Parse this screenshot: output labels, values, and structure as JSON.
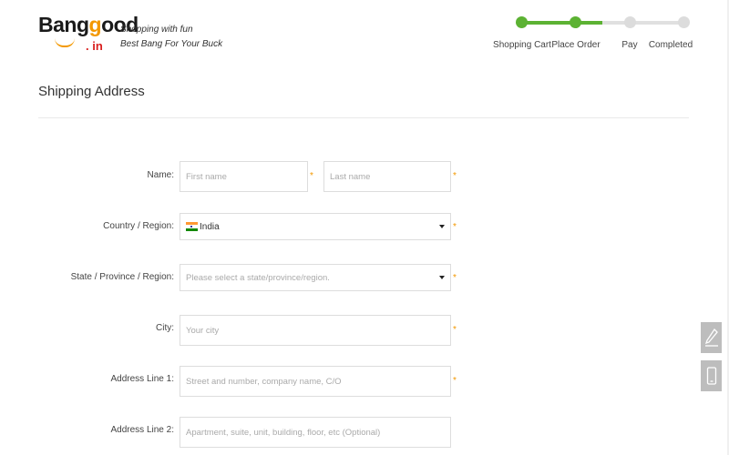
{
  "brand": {
    "word_part1": "Bang",
    "word_g": "g",
    "word_part2": "ood",
    "suffix": ". in",
    "tagline_1": "Shopping with fun",
    "tagline_2": "Best Bang For Your Buck"
  },
  "progress": {
    "steps": [
      {
        "label": "Shopping Cart",
        "state": "done"
      },
      {
        "label": "Place Order",
        "state": "done"
      },
      {
        "label": "Pay",
        "state": "todo"
      },
      {
        "label": "Completed",
        "state": "todo"
      }
    ],
    "active_color": "#5cb233",
    "inactive_color": "#dcdcdc"
  },
  "page": {
    "title": "Shipping Address"
  },
  "form": {
    "required_mark": "*",
    "name_label": "Name:",
    "first_name_placeholder": "First name",
    "last_name_placeholder": "Last name",
    "country_label": "Country / Region:",
    "country_value": "India",
    "state_label": "State / Province / Region:",
    "state_placeholder": "Please select a state/province/region.",
    "city_label": "City:",
    "city_placeholder": "Your city",
    "address1_label": "Address Line 1:",
    "address1_placeholder": "Street and number, company name, C/O",
    "address2_label": "Address Line 2:",
    "address2_placeholder": "Apartment, suite, unit, building, floor, etc (Optional)"
  },
  "side_tools": [
    {
      "icon": "pencil-icon"
    },
    {
      "icon": "mobile-icon"
    }
  ]
}
